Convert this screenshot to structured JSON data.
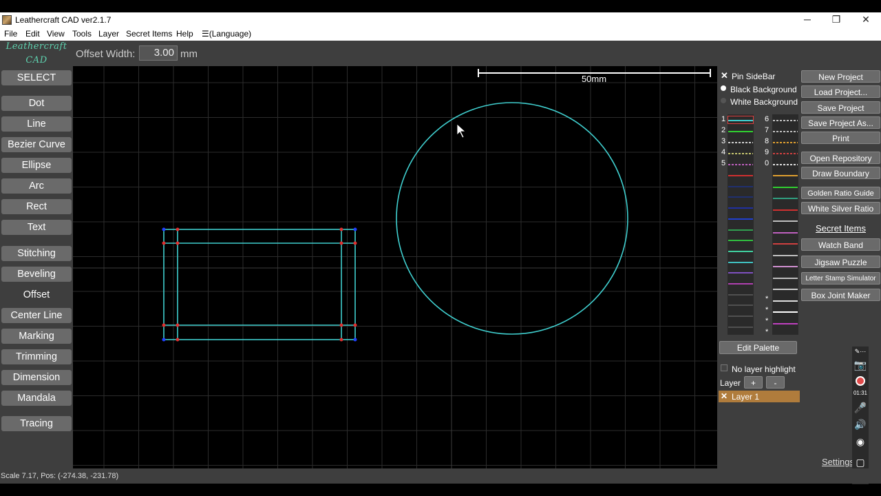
{
  "window": {
    "title": "Leathercraft CAD ver2.1.7",
    "minimize": "─",
    "restore": "❐",
    "close": "✕"
  },
  "menu": [
    "File",
    "Edit",
    "View",
    "Tools",
    "Layer",
    "Secret Items",
    "Help",
    "(Language)"
  ],
  "logo": [
    "Leathercraft",
    "CAD"
  ],
  "tools": {
    "select": "SELECT",
    "dot": "Dot",
    "line": "Line",
    "bezier": "Bezier Curve",
    "ellipse": "Ellipse",
    "arc": "Arc",
    "rect": "Rect",
    "text": "Text",
    "stitching": "Stitching",
    "beveling": "Beveling",
    "offset": "Offset",
    "center_line": "Center Line",
    "marking": "Marking",
    "trimming": "Trimming",
    "dimension": "Dimension",
    "mandala": "Mandala",
    "tracing": "Tracing"
  },
  "offset": {
    "label": "Offset Width:",
    "value": "3.00",
    "unit": "mm"
  },
  "canvas": {
    "scale_label": "50mm",
    "stroke_color": "#40d0d0",
    "red_point": "#e03030",
    "blue_point": "#2040ff"
  },
  "sidebar": {
    "pin": "Pin SideBar",
    "black_bg": "Black Background",
    "white_bg": "White Background",
    "palette_left_nums": [
      "1",
      "2",
      "3",
      "4",
      "5"
    ],
    "palette_right_nums": [
      "6",
      "7",
      "8",
      "9",
      "0"
    ],
    "stars": [
      "*",
      "*",
      "*",
      "*"
    ],
    "edit_palette": "Edit Palette",
    "no_layer_highlight": "No layer highlight",
    "layer_label": "Layer",
    "layer_add": "+",
    "layer_remove": "-",
    "layer1": "Layer 1",
    "settings": "Settings"
  },
  "right_buttons": {
    "new_project": "New Project",
    "load_project": "Load Project...",
    "save_project": "Save Project",
    "save_project_as": "Save Project As...",
    "print": "Print",
    "open_repo": "Open Repository",
    "draw_boundary": "Draw Boundary",
    "golden_ratio": "Golden Ratio Guide",
    "white_silver": "White Silver Ratio",
    "secret_items": "Secret Items",
    "watch_band": "Watch Band",
    "jigsaw": "Jigsaw Puzzle",
    "letter_stamp": "Letter Stamp Simulator",
    "box_joint": "Box Joint Maker"
  },
  "recorder": {
    "timer": "01:31"
  },
  "status": "Scale 7.17, Pos: (-274.38, -231.78)"
}
